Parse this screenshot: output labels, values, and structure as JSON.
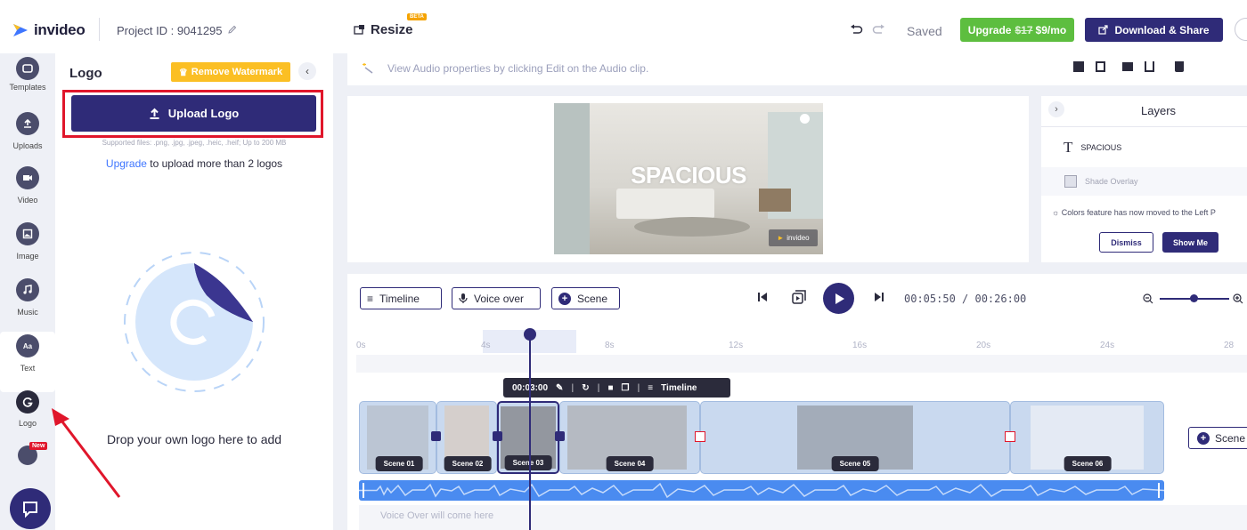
{
  "topbar": {
    "brand": "invideo",
    "project_id": "Project ID : 9041295",
    "resize_label": "Resize",
    "beta_badge": "BETA",
    "saved_label": "Saved",
    "upgrade_prefix": "Upgrade",
    "upgrade_old_price": "$17",
    "upgrade_price": "$9/mo",
    "download_label": "Download & Share"
  },
  "rail": {
    "items": [
      {
        "label": "Templates",
        "icon": "templates-icon"
      },
      {
        "label": "Uploads",
        "icon": "upload-icon"
      },
      {
        "label": "Video",
        "icon": "video-icon"
      },
      {
        "label": "Image",
        "icon": "image-icon"
      },
      {
        "label": "Music",
        "icon": "music-icon"
      },
      {
        "label": "Text",
        "icon": "text-icon"
      },
      {
        "label": "Logo",
        "icon": "logo-icon",
        "active": true
      }
    ],
    "new_badge": "New"
  },
  "logo_panel": {
    "title": "Logo",
    "remove_watermark": "Remove Watermark",
    "upload_button": "Upload Logo",
    "supported_files": "Supported files: .png, .jpg, .jpeg, .heic, .heif; Up to 200 MB",
    "upgrade_link": "Upgrade",
    "upgrade_rest": " to upload more than 2 logos",
    "drop_text": "Drop your own logo here to add"
  },
  "hint": {
    "text": "View Audio properties by clicking Edit on the Audio clip."
  },
  "preview": {
    "overlay_text": "SPACIOUS",
    "watermark": "invideo"
  },
  "layers": {
    "title": "Layers",
    "items": [
      {
        "label": "SPACIOUS",
        "icon": "text-layer-icon"
      },
      {
        "label": "Shade Overlay",
        "icon": "image-layer-icon"
      }
    ],
    "note": "Colors feature has now moved to the Left P",
    "dismiss": "Dismiss",
    "show_me": "Show Me"
  },
  "timeline": {
    "timeline_btn": "Timeline",
    "voiceover_btn": "Voice over",
    "scene_btn": "Scene",
    "time_current": "00:05:50",
    "time_sep": " / ",
    "time_total": "00:26:00",
    "ticks": [
      "0s",
      "4s",
      "8s",
      "12s",
      "16s",
      "20s",
      "24s",
      "28"
    ],
    "clip_time": "00:03:00",
    "clip_timeline": "Timeline",
    "scenes": [
      "Scene 01",
      "Scene 02",
      "Scene 03",
      "Scene 04",
      "Scene 05",
      "Scene 06"
    ],
    "add_scene": "Scene",
    "voiceover_placeholder": "Voice Over will come here"
  },
  "colors": {
    "brand_navy": "#2f2b78",
    "upgrade_green": "#5dbe3f",
    "watermark_yellow": "#fbbf24",
    "highlight_red": "#e0162b",
    "audio_blue": "#4a8bf0"
  }
}
